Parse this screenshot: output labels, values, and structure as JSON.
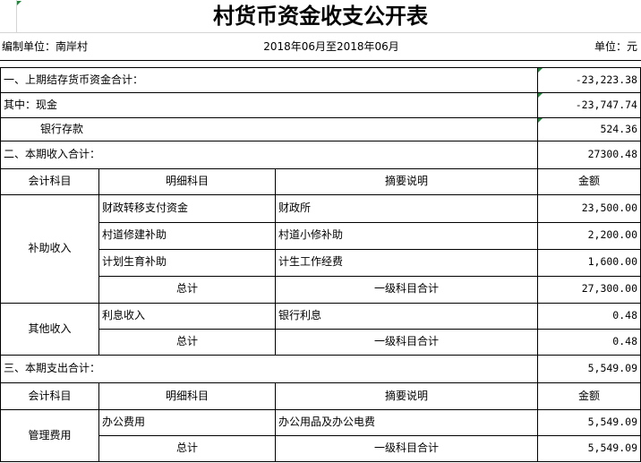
{
  "title": "村货币资金收支公开表",
  "meta": {
    "unit_label": "编制单位：南岸村",
    "period": "2018年06月至2018年06月",
    "currency": "单位：元"
  },
  "summary": {
    "prev_balance_label": "一、上期结存货币资金合计：",
    "prev_balance_value": "-23,223.38",
    "cash_label": "其中：现金",
    "cash_value": "-23,747.74",
    "bank_label": "银行存款",
    "bank_value": "524.36",
    "income_total_label": "二、本期收入合计：",
    "income_total_value": "27300.48",
    "expense_total_label": "三、本期支出合计：",
    "expense_total_value": "5,549.09"
  },
  "headers": {
    "account": "会计科目",
    "detail": "明细科目",
    "desc": "摘要说明",
    "amount": "金额"
  },
  "income_headers": {
    "account": "会计科目",
    "detail": "明细科目",
    "desc": "摘要说明",
    "amount": "金额"
  },
  "subsidy": {
    "category": "补助收入",
    "rows": [
      {
        "detail": "财政转移支付资金",
        "desc": "财政所",
        "amount": "23,500.00"
      },
      {
        "detail": "村道修建补助",
        "desc": "村道小修补助",
        "amount": "2,200.00"
      },
      {
        "detail": "计划生育补助",
        "desc": "计生工作经费",
        "amount": "1,600.00"
      }
    ],
    "total": {
      "detail": "总计",
      "desc": "一级科目合计",
      "amount": "27,300.00"
    }
  },
  "other_income": {
    "category": "其他收入",
    "rows": [
      {
        "detail": "利息收入",
        "desc": "银行利息",
        "amount": "0.48"
      }
    ],
    "total": {
      "detail": "总计",
      "desc": "一级科目合计",
      "amount": "0.48"
    }
  },
  "expense_headers": {
    "account": "会计科目",
    "detail": "明细科目",
    "desc": "摘要说明",
    "amount": "金额"
  },
  "management": {
    "category": "管理费用",
    "rows": [
      {
        "detail": "办公费用",
        "desc": "办公用品及办公电费",
        "amount": "5,549.09"
      }
    ],
    "total": {
      "detail": "总计",
      "desc": "一级科目合计",
      "amount": "5,549.09"
    }
  },
  "colors": {
    "cell_marker": "#1d8a3b"
  }
}
